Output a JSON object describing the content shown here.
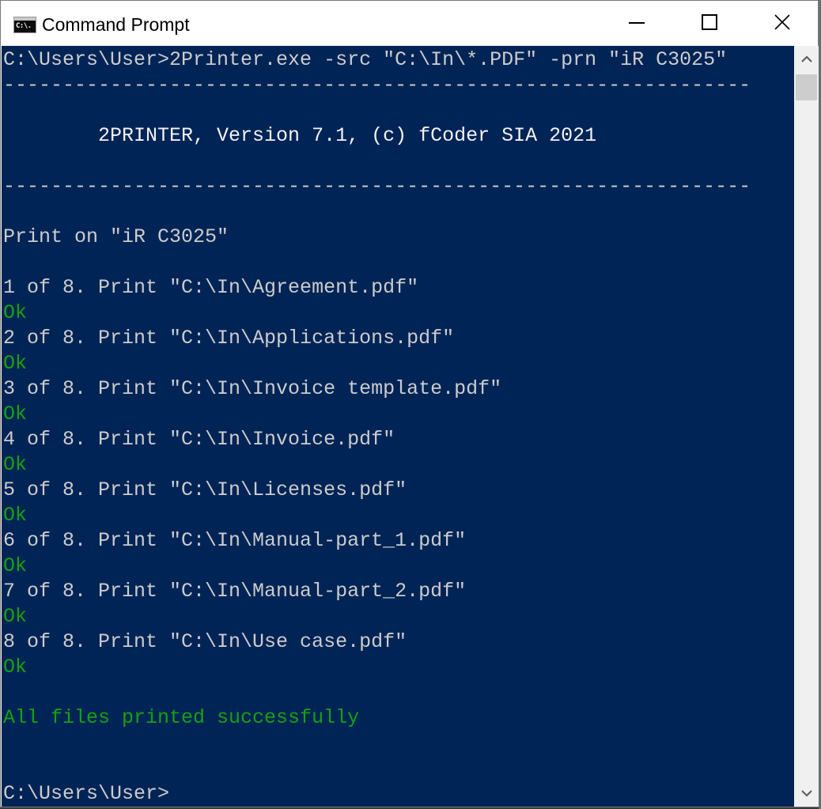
{
  "window": {
    "title": "Command Prompt",
    "icon": "cmd-icon",
    "icon_glyph": "C:\\.",
    "controls": [
      "minimize",
      "maximize",
      "close"
    ]
  },
  "colors": {
    "console_background": "#012456",
    "text_default": "#cccccc",
    "text_bright": "#f2f2f2",
    "text_success": "#13a10e",
    "scrollbar_track": "#f0f0f0",
    "scrollbar_thumb": "#cdcdcd"
  },
  "console": {
    "lines": [
      {
        "text": "C:\\Users\\User>2Printer.exe -src \"C:\\In\\*.PDF\" -prn \"iR C3025\"",
        "style": "normal"
      },
      {
        "text": "---------------------------------------------------------------",
        "style": "normal"
      },
      {
        "text": "",
        "style": "normal"
      },
      {
        "text": "        2PRINTER, Version 7.1, (c) fCoder SIA 2021",
        "style": "bright"
      },
      {
        "text": "",
        "style": "normal"
      },
      {
        "text": "---------------------------------------------------------------",
        "style": "normal"
      },
      {
        "text": "",
        "style": "normal"
      },
      {
        "text": "Print on \"iR C3025\"",
        "style": "normal"
      },
      {
        "text": "",
        "style": "normal"
      },
      {
        "text": "1 of 8. Print \"C:\\In\\Agreement.pdf\"",
        "style": "normal"
      },
      {
        "text": "Ok",
        "style": "ok"
      },
      {
        "text": "2 of 8. Print \"C:\\In\\Applications.pdf\"",
        "style": "normal"
      },
      {
        "text": "Ok",
        "style": "ok"
      },
      {
        "text": "3 of 8. Print \"C:\\In\\Invoice template.pdf\"",
        "style": "normal"
      },
      {
        "text": "Ok",
        "style": "ok"
      },
      {
        "text": "4 of 8. Print \"C:\\In\\Invoice.pdf\"",
        "style": "normal"
      },
      {
        "text": "Ok",
        "style": "ok"
      },
      {
        "text": "5 of 8. Print \"C:\\In\\Licenses.pdf\"",
        "style": "normal"
      },
      {
        "text": "Ok",
        "style": "ok"
      },
      {
        "text": "6 of 8. Print \"C:\\In\\Manual-part_1.pdf\"",
        "style": "normal"
      },
      {
        "text": "Ok",
        "style": "ok"
      },
      {
        "text": "7 of 8. Print \"C:\\In\\Manual-part_2.pdf\"",
        "style": "normal"
      },
      {
        "text": "Ok",
        "style": "ok"
      },
      {
        "text": "8 of 8. Print \"C:\\In\\Use case.pdf\"",
        "style": "normal"
      },
      {
        "text": "Ok",
        "style": "ok"
      },
      {
        "text": "",
        "style": "normal"
      },
      {
        "text": "All files printed successfully",
        "style": "ok"
      },
      {
        "text": "",
        "style": "normal"
      },
      {
        "text": "",
        "style": "normal"
      },
      {
        "text": "C:\\Users\\User>",
        "style": "normal"
      }
    ]
  },
  "scrollbar": {
    "up_icon": "chevron-up-icon",
    "down_icon": "chevron-down-icon",
    "position": 0.0
  }
}
